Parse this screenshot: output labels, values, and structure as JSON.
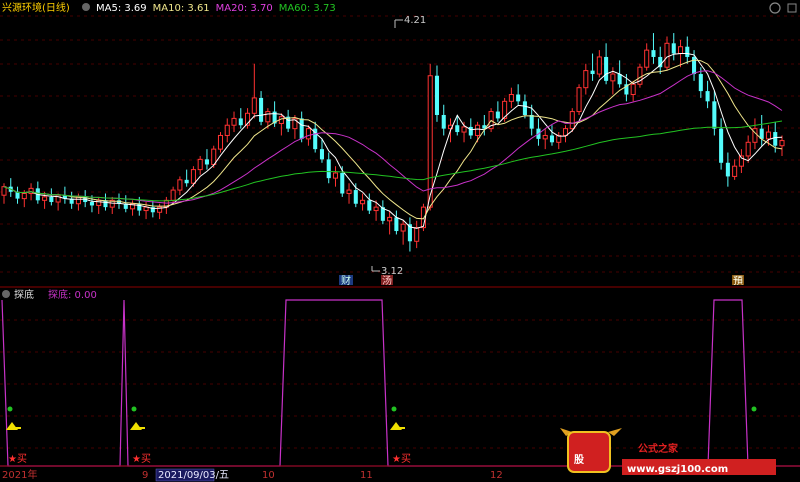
{
  "header": {
    "stock_name": "兴源环境(日线)",
    "indicators": [
      {
        "label": "MA5: 3.69",
        "color": "#ffffff"
      },
      {
        "label": "MA10: 3.61",
        "color": "#f0e68c"
      },
      {
        "label": "MA20: 3.70",
        "color": "#e040e0"
      },
      {
        "label": "MA60: 3.73",
        "color": "#22c322"
      }
    ]
  },
  "sub_panel": {
    "title": "探底",
    "value_label": "探底: 0.00"
  },
  "price_annotations": {
    "high": "4.21",
    "low": "3.12"
  },
  "event_markers": [
    {
      "text": "财",
      "color": "#3a6fd8"
    },
    {
      "text": "汤",
      "color": "#d84040"
    },
    {
      "text": "預",
      "color": "#e0a020"
    }
  ],
  "buy_label": "买",
  "x_axis": {
    "labels": [
      "2021年",
      "9",
      "2021/09/03/五",
      "10",
      "11",
      "12"
    ]
  },
  "watermark": {
    "logo_text": "股",
    "title": "公式之家",
    "url": "www.gszj100.com"
  },
  "colors": {
    "background": "#000000",
    "up_candle": "#ff3232",
    "down_candle": "#54fcfc",
    "ma5": "#ffffff",
    "ma10": "#f0e68c",
    "ma20": "#c832c8",
    "ma60": "#22c322",
    "grid": "#8b0000",
    "signal": "#c832c8",
    "buy_dot": "#22c322",
    "buy_arrow": "#f0e000"
  },
  "chart_data": [
    {
      "type": "candlestick",
      "title": "兴源环境(日线)",
      "series": [
        {
          "name": "MA5",
          "last": 3.69
        },
        {
          "name": "MA10",
          "last": 3.61
        },
        {
          "name": "MA20",
          "last": 3.7
        },
        {
          "name": "MA60",
          "last": 3.73
        }
      ],
      "candles": [
        [
          3.45,
          3.52,
          3.4,
          3.5
        ],
        [
          3.5,
          3.55,
          3.44,
          3.47
        ],
        [
          3.47,
          3.5,
          3.4,
          3.43
        ],
        [
          3.43,
          3.48,
          3.38,
          3.46
        ],
        [
          3.46,
          3.52,
          3.42,
          3.49
        ],
        [
          3.49,
          3.53,
          3.4,
          3.42
        ],
        [
          3.42,
          3.47,
          3.37,
          3.44
        ],
        [
          3.44,
          3.49,
          3.39,
          3.41
        ],
        [
          3.41,
          3.46,
          3.36,
          3.45
        ],
        [
          3.45,
          3.5,
          3.4,
          3.43
        ],
        [
          3.43,
          3.47,
          3.37,
          3.4
        ],
        [
          3.4,
          3.46,
          3.36,
          3.44
        ],
        [
          3.44,
          3.48,
          3.38,
          3.41
        ],
        [
          3.41,
          3.45,
          3.35,
          3.39
        ],
        [
          3.39,
          3.44,
          3.34,
          3.42
        ],
        [
          3.42,
          3.46,
          3.36,
          3.38
        ],
        [
          3.38,
          3.44,
          3.34,
          3.42
        ],
        [
          3.42,
          3.46,
          3.37,
          3.4
        ],
        [
          3.4,
          3.45,
          3.35,
          3.37
        ],
        [
          3.37,
          3.42,
          3.33,
          3.4
        ],
        [
          3.4,
          3.44,
          3.33,
          3.36
        ],
        [
          3.36,
          3.41,
          3.31,
          3.38
        ],
        [
          3.38,
          3.42,
          3.32,
          3.35
        ],
        [
          3.35,
          3.4,
          3.31,
          3.38
        ],
        [
          3.38,
          3.44,
          3.34,
          3.42
        ],
        [
          3.42,
          3.5,
          3.4,
          3.48
        ],
        [
          3.48,
          3.56,
          3.45,
          3.54
        ],
        [
          3.54,
          3.6,
          3.5,
          3.52
        ],
        [
          3.52,
          3.62,
          3.5,
          3.6
        ],
        [
          3.6,
          3.68,
          3.57,
          3.66
        ],
        [
          3.66,
          3.72,
          3.6,
          3.63
        ],
        [
          3.63,
          3.74,
          3.61,
          3.72
        ],
        [
          3.72,
          3.82,
          3.7,
          3.8
        ],
        [
          3.8,
          3.9,
          3.76,
          3.86
        ],
        [
          3.86,
          3.94,
          3.82,
          3.9
        ],
        [
          3.9,
          3.96,
          3.84,
          3.86
        ],
        [
          3.86,
          3.96,
          3.84,
          3.93
        ],
        [
          3.93,
          4.22,
          3.9,
          4.02
        ],
        [
          4.02,
          4.06,
          3.86,
          3.88
        ],
        [
          3.88,
          3.96,
          3.84,
          3.94
        ],
        [
          3.94,
          4.0,
          3.85,
          3.87
        ],
        [
          3.87,
          3.93,
          3.8,
          3.91
        ],
        [
          3.91,
          3.95,
          3.82,
          3.84
        ],
        [
          3.84,
          3.92,
          3.78,
          3.9
        ],
        [
          3.9,
          3.94,
          3.76,
          3.78
        ],
        [
          3.78,
          3.86,
          3.74,
          3.84
        ],
        [
          3.84,
          3.88,
          3.7,
          3.72
        ],
        [
          3.72,
          3.78,
          3.64,
          3.66
        ],
        [
          3.66,
          3.7,
          3.52,
          3.55
        ],
        [
          3.55,
          3.62,
          3.5,
          3.58
        ],
        [
          3.58,
          3.62,
          3.44,
          3.46
        ],
        [
          3.46,
          3.52,
          3.4,
          3.48
        ],
        [
          3.48,
          3.52,
          3.38,
          3.4
        ],
        [
          3.4,
          3.46,
          3.36,
          3.42
        ],
        [
          3.42,
          3.46,
          3.34,
          3.36
        ],
        [
          3.36,
          3.42,
          3.3,
          3.38
        ],
        [
          3.38,
          3.42,
          3.28,
          3.3
        ],
        [
          3.3,
          3.36,
          3.22,
          3.32
        ],
        [
          3.32,
          3.36,
          3.22,
          3.24
        ],
        [
          3.24,
          3.3,
          3.16,
          3.28
        ],
        [
          3.28,
          3.32,
          3.12,
          3.18
        ],
        [
          3.18,
          3.3,
          3.14,
          3.26
        ],
        [
          3.26,
          3.4,
          3.24,
          3.38
        ],
        [
          3.38,
          4.22,
          3.36,
          4.15
        ],
        [
          4.15,
          4.21,
          3.88,
          3.92
        ],
        [
          3.92,
          3.98,
          3.8,
          3.84
        ],
        [
          3.84,
          3.9,
          3.76,
          3.86
        ],
        [
          3.86,
          3.92,
          3.8,
          3.82
        ],
        [
          3.82,
          3.88,
          3.76,
          3.85
        ],
        [
          3.85,
          3.9,
          3.78,
          3.8
        ],
        [
          3.8,
          3.88,
          3.76,
          3.86
        ],
        [
          3.86,
          3.92,
          3.8,
          3.84
        ],
        [
          3.84,
          3.96,
          3.82,
          3.94
        ],
        [
          3.94,
          4.0,
          3.88,
          3.9
        ],
        [
          3.9,
          4.02,
          3.88,
          4.0
        ],
        [
          4.0,
          4.08,
          3.96,
          4.04
        ],
        [
          4.04,
          4.1,
          3.98,
          4.0
        ],
        [
          4.0,
          4.04,
          3.9,
          3.92
        ],
        [
          3.92,
          3.98,
          3.8,
          3.84
        ],
        [
          3.84,
          3.9,
          3.74,
          3.78
        ],
        [
          3.78,
          3.84,
          3.72,
          3.8
        ],
        [
          3.8,
          3.86,
          3.74,
          3.76
        ],
        [
          3.76,
          3.82,
          3.72,
          3.8
        ],
        [
          3.8,
          3.86,
          3.76,
          3.84
        ],
        [
          3.84,
          3.96,
          3.82,
          3.94
        ],
        [
          3.94,
          4.1,
          3.92,
          4.08
        ],
        [
          4.08,
          4.22,
          4.04,
          4.18
        ],
        [
          4.18,
          4.28,
          4.12,
          4.16
        ],
        [
          4.16,
          4.3,
          4.14,
          4.26
        ],
        [
          4.26,
          4.34,
          4.1,
          4.12
        ],
        [
          4.12,
          4.2,
          4.04,
          4.16
        ],
        [
          4.16,
          4.24,
          4.08,
          4.1
        ],
        [
          4.1,
          4.16,
          4.0,
          4.04
        ],
        [
          4.04,
          4.12,
          4.0,
          4.1
        ],
        [
          4.1,
          4.22,
          4.08,
          4.2
        ],
        [
          4.2,
          4.34,
          4.18,
          4.3
        ],
        [
          4.3,
          4.4,
          4.22,
          4.26
        ],
        [
          4.26,
          4.32,
          4.16,
          4.2
        ],
        [
          4.2,
          4.38,
          4.18,
          4.34
        ],
        [
          4.34,
          4.4,
          4.24,
          4.28
        ],
        [
          4.28,
          4.36,
          4.2,
          4.32
        ],
        [
          4.32,
          4.38,
          4.22,
          4.26
        ],
        [
          4.26,
          4.3,
          4.12,
          4.16
        ],
        [
          4.16,
          4.2,
          4.02,
          4.06
        ],
        [
          4.06,
          4.12,
          3.96,
          4.0
        ],
        [
          4.0,
          4.06,
          3.8,
          3.84
        ],
        [
          3.84,
          3.9,
          3.6,
          3.64
        ],
        [
          3.64,
          3.7,
          3.5,
          3.56
        ],
        [
          3.56,
          3.66,
          3.54,
          3.62
        ],
        [
          3.62,
          3.72,
          3.58,
          3.68
        ],
        [
          3.68,
          3.8,
          3.64,
          3.76
        ],
        [
          3.76,
          3.9,
          3.72,
          3.84
        ],
        [
          3.84,
          3.92,
          3.74,
          3.78
        ],
        [
          3.78,
          3.86,
          3.74,
          3.82
        ],
        [
          3.82,
          3.88,
          3.7,
          3.74
        ],
        [
          3.74,
          3.8,
          3.68,
          3.77
        ]
      ],
      "annotations": {
        "high": 4.21,
        "low": 3.12
      }
    },
    {
      "type": "line",
      "title": "探底",
      "series": [
        {
          "name": "探底",
          "last": 0.0
        }
      ],
      "signal_windows": [
        {
          "start": 0,
          "end": 1
        },
        {
          "start": 33,
          "end": 34
        },
        {
          "start": 79,
          "end": 106
        },
        {
          "start": 200,
          "end": 212
        }
      ],
      "buy_signals": 4
    }
  ]
}
